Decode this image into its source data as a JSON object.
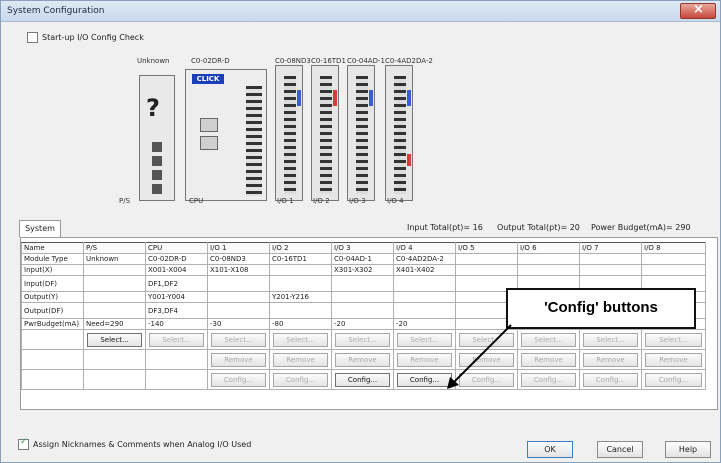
{
  "window": {
    "title": "System Configuration"
  },
  "startup_check": {
    "label": "Start-up I/O Config Check",
    "checked": false
  },
  "hardware": {
    "module_labels": [
      "Unknown",
      "C0-02DR-D",
      "C0-08ND3",
      "C0-16TD1",
      "C0-04AD-1",
      "C0-4AD2DA-2"
    ],
    "slot_labels": [
      "P/S",
      "CPU",
      "I/O 1",
      "I/O 2",
      "I/O 3",
      "I/O 4"
    ],
    "cpu_logo": "CLICK",
    "unknown_symbol": "?"
  },
  "tab": {
    "label": "System"
  },
  "totals": {
    "input": "Input Total(pt)= 16",
    "output": "Output Total(pt)= 20",
    "power": "Power Budget(mA)= 290"
  },
  "grid": {
    "columns": [
      "Name",
      "P/S",
      "CPU",
      "I/O 1",
      "I/O 2",
      "I/O 3",
      "I/O 4",
      "I/O 5",
      "I/O 6",
      "I/O 7",
      "I/O 8"
    ],
    "rows": [
      {
        "name": "Module Type",
        "cells": [
          "Unknown",
          "C0-02DR-D",
          "C0-08ND3",
          "C0-16TD1",
          "C0-04AD-1",
          "C0-4AD2DA-2",
          "",
          "",
          "",
          ""
        ]
      },
      {
        "name": "Input(X)",
        "cells": [
          "",
          "X001-X004",
          "X101-X108",
          "",
          "X301-X302",
          "X401-X402",
          "",
          "",
          "",
          ""
        ]
      },
      {
        "name": "Input(DF)",
        "cells": [
          "",
          "DF1,DF2",
          "",
          "",
          "",
          "",
          "",
          "",
          "",
          ""
        ],
        "tall": true
      },
      {
        "name": "Output(Y)",
        "cells": [
          "",
          "Y001-Y004",
          "",
          "Y201-Y216",
          "",
          "",
          "",
          "",
          "",
          ""
        ]
      },
      {
        "name": "Output(DF)",
        "cells": [
          "",
          "DF3,DF4",
          "",
          "",
          "",
          "",
          "",
          "",
          "",
          ""
        ],
        "tall": true
      },
      {
        "name": "PwrBudget(mA)",
        "cells": [
          "Need=290",
          "-140",
          "-30",
          "-80",
          "-20",
          "-20",
          "",
          "",
          "",
          ""
        ]
      }
    ],
    "select_label": "Select...",
    "remove_label": "Remove",
    "config_label": "Config..."
  },
  "callout": {
    "text": "'Config' buttons"
  },
  "bottom": {
    "nickname_label": "Assign Nicknames & Comments when Analog I/O Used",
    "nickname_checked": true,
    "ok": "OK",
    "cancel": "Cancel",
    "help": "Help"
  }
}
